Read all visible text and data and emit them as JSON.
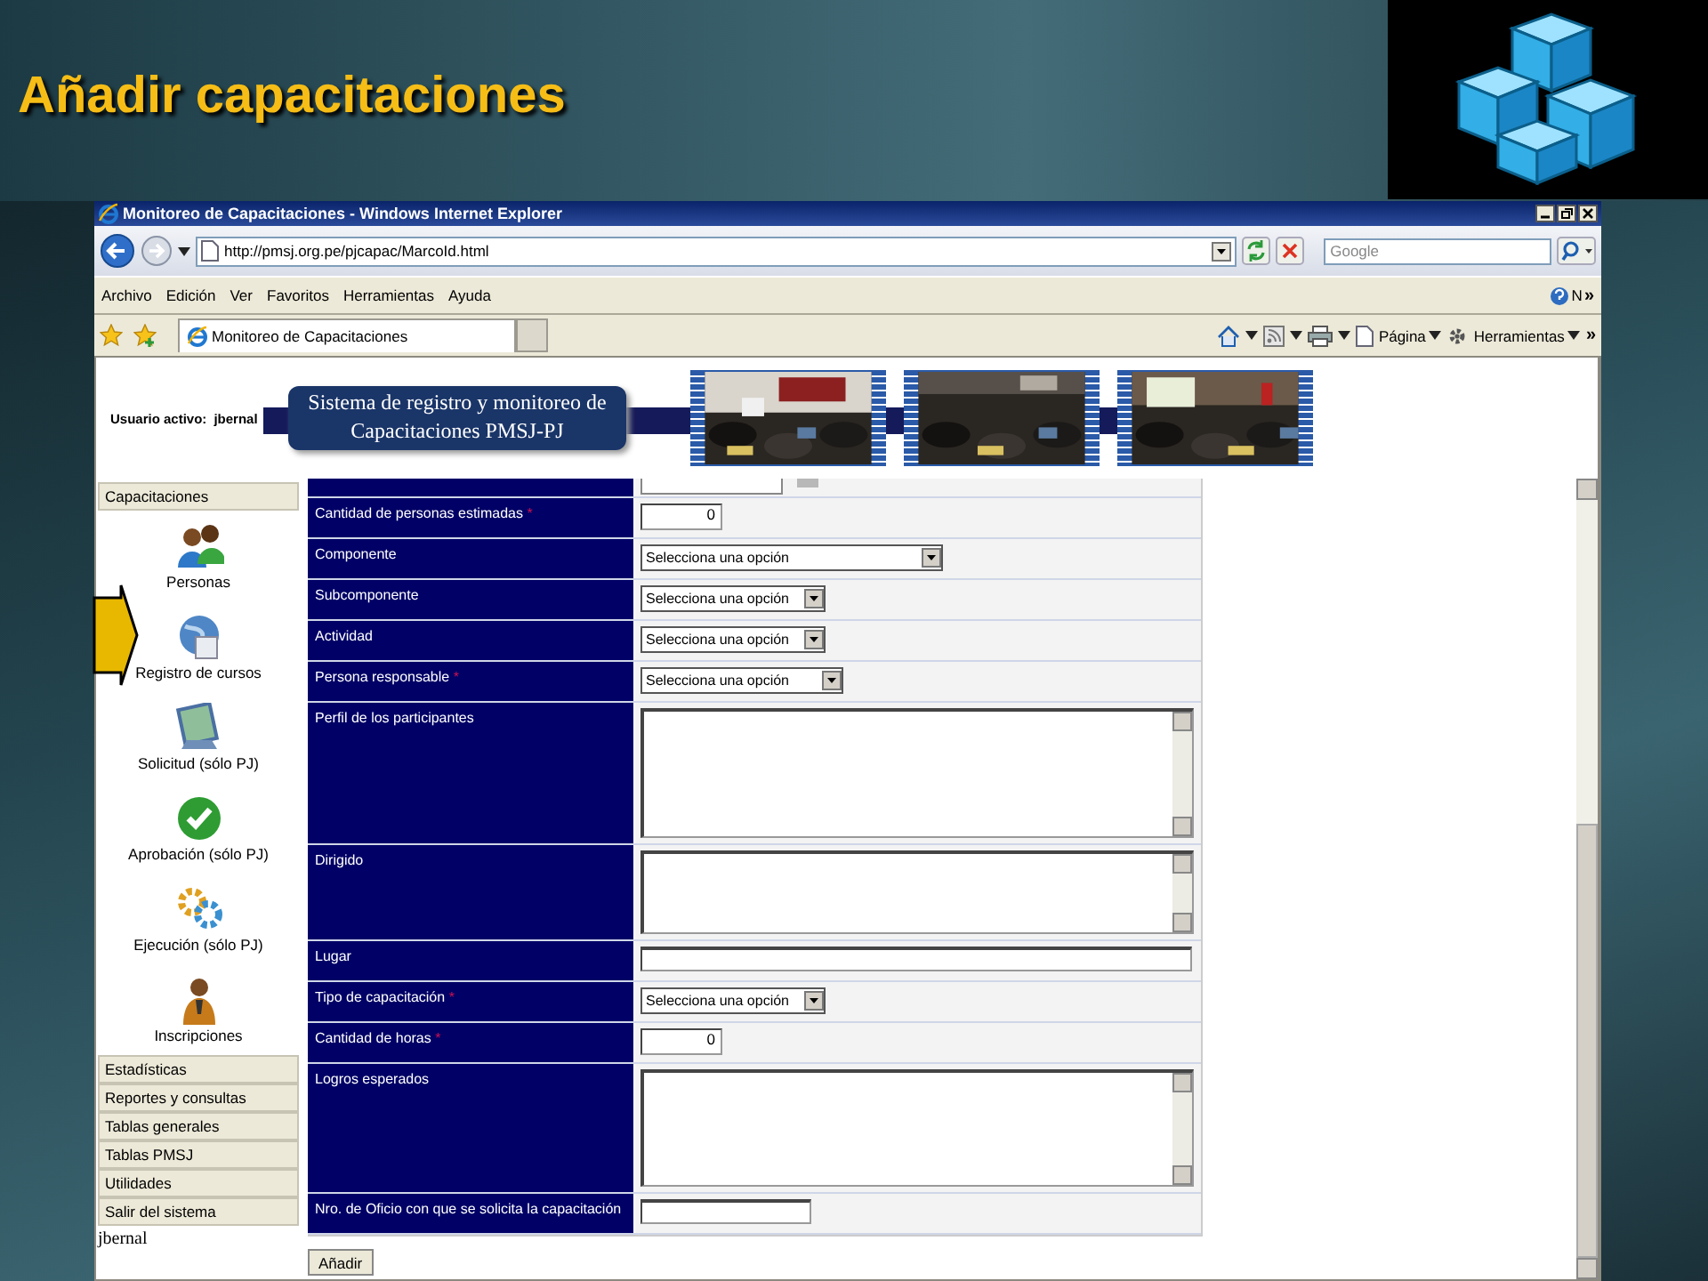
{
  "slide": {
    "title": "Añadir capacitaciones"
  },
  "window": {
    "title": "Monitoreo de Capacitaciones - Windows Internet Explorer"
  },
  "address_bar": {
    "value": "http://pmsj.org.pe/pjcapac/MarcoId.html"
  },
  "search": {
    "placeholder": "Google"
  },
  "menu": [
    "Archivo",
    "Edición",
    "Ver",
    "Favoritos",
    "Herramientas",
    "Ayuda"
  ],
  "menu_right": {
    "label": "N",
    "overflow": "»"
  },
  "tabs": [
    {
      "label": "Monitoreo de Capacitaciones",
      "selected": true
    }
  ],
  "command_bar": {
    "items": [
      "Página",
      "Herramientas"
    ],
    "overflow": "»"
  },
  "banner": {
    "user_label": "Usuario activo:",
    "user": "jbernal",
    "heading": "Sistema de registro y monitoreo de Capacitaciones PMSJ-PJ"
  },
  "sidebar": {
    "header": "Capacitaciones",
    "items": [
      {
        "label": "Personas"
      },
      {
        "label": "Registro de cursos"
      },
      {
        "label": "Solicitud (sólo PJ)"
      },
      {
        "label": "Aprobación (sólo PJ)"
      },
      {
        "label": "Ejecución (sólo PJ)"
      },
      {
        "label": "Inscripciones"
      }
    ],
    "menu": [
      "Estadísticas",
      "Reportes y consultas",
      "Tablas generales",
      "Tablas PMSJ",
      "Utilidades",
      "Salir del sistema"
    ],
    "footer": "jbernal"
  },
  "form": {
    "rows": [
      {
        "kind": "date"
      },
      {
        "label": "Cantidad de personas estimadas",
        "mark": "*",
        "kind": "number",
        "value": "0"
      },
      {
        "label": "Componente",
        "kind": "select",
        "value": "Selecciona una opción"
      },
      {
        "label": "Subcomponente",
        "kind": "select",
        "value": "Selecciona una opción"
      },
      {
        "label": "Actividad",
        "kind": "select",
        "value": "Selecciona una opción"
      },
      {
        "label": "Persona responsable",
        "mark": "*",
        "kind": "select",
        "value": "Selecciona una opción"
      },
      {
        "label": "Perfil de los participantes",
        "kind": "textarea"
      },
      {
        "label": "Dirigido",
        "kind": "textarea"
      },
      {
        "label": "Lugar",
        "kind": "text"
      },
      {
        "label": "Tipo de capacitación",
        "mark": "*",
        "kind": "select",
        "value": "Selecciona una opción"
      },
      {
        "label": "Cantidad de horas",
        "mark": "*",
        "kind": "number",
        "value": "0"
      },
      {
        "label": "Logros esperados",
        "kind": "textarea"
      },
      {
        "label": "Nro. de Oficio con que se solicita la capacitación",
        "kind": "text"
      }
    ],
    "submit": "Añadir"
  }
}
